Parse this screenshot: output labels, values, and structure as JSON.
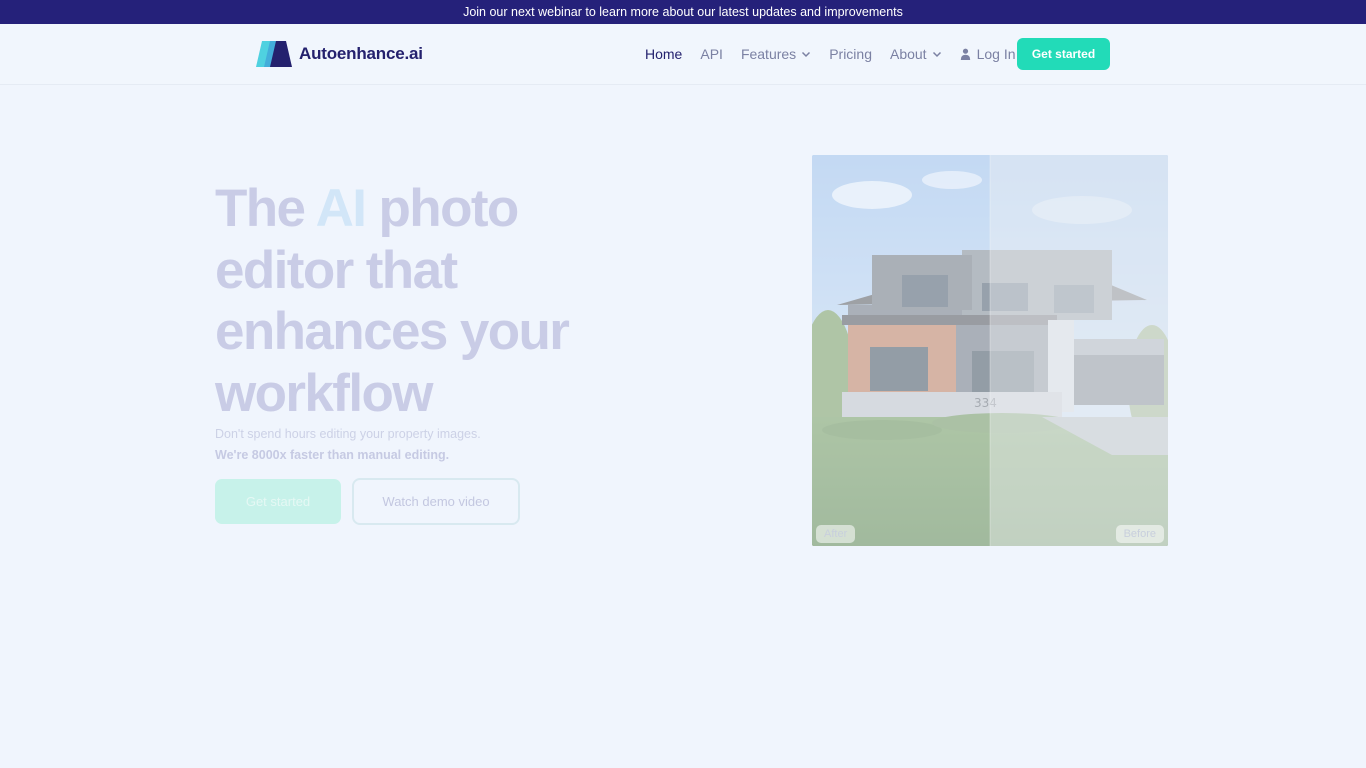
{
  "banner": {
    "text": "Join our next webinar to learn more about our latest updates and improvements"
  },
  "brand": {
    "name": "Autoenhance.ai",
    "colors": {
      "primary": "#24216e",
      "accent": "#22dbb8",
      "banner": "#25217a",
      "background": "#f0f5fd"
    }
  },
  "nav": {
    "items": [
      {
        "label": "Home",
        "active": true
      },
      {
        "label": "API"
      },
      {
        "label": "Features",
        "icon": "chevron-down-icon"
      },
      {
        "label": "Pricing"
      },
      {
        "label": "About",
        "icon": "chevron-down-icon"
      }
    ],
    "login": {
      "label": "Log In",
      "icon": "person-icon"
    },
    "cta": "Get started"
  },
  "hero": {
    "title_pre": "The ",
    "title_accent": "AI",
    "title_post": " photo editor that enhances your workflow",
    "subtitle": "Don't spend hours editing your property images.",
    "subtitle_bold": "We're 8000x faster than manual editing.",
    "primary_button": "Get started",
    "secondary_button": "Watch demo video"
  },
  "comparison": {
    "after_label": "After",
    "before_label": "Before",
    "house_number": "334"
  }
}
